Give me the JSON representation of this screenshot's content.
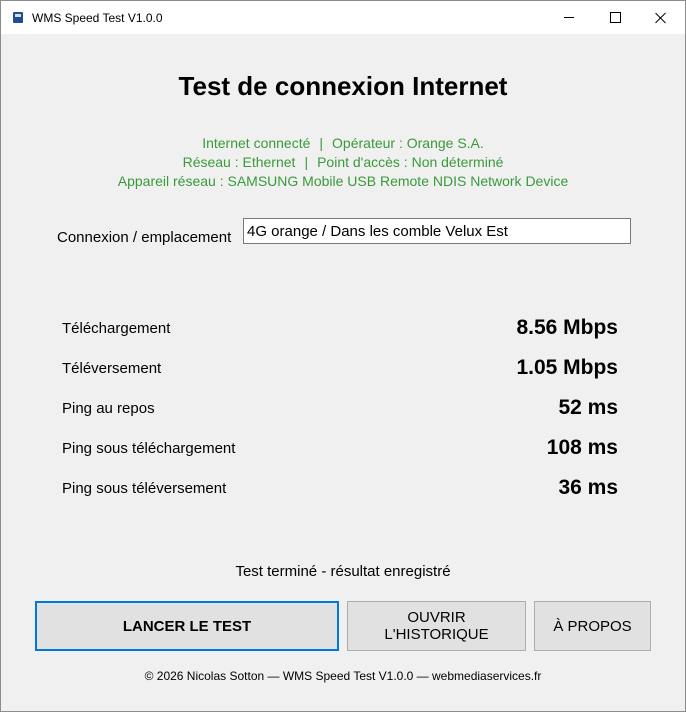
{
  "window": {
    "title": "WMS Speed Test V1.0.0",
    "minimize_icon": "minimize-icon",
    "maximize_icon": "maximize-icon",
    "close_icon": "close-icon"
  },
  "header": {
    "title": "Test de connexion Internet"
  },
  "status": {
    "connected": "Internet connecté",
    "operator": "Opérateur : Orange S.A.",
    "network": "Réseau : Ethernet",
    "access_point": "Point d'accès : Non déterminé",
    "device": "Appareil réseau : SAMSUNG Mobile USB Remote NDIS Network Device",
    "separator": "|",
    "color": "#3a9a3a"
  },
  "location": {
    "label": "Connexion / emplacement",
    "value": "4G orange / Dans les comble Velux Est"
  },
  "metrics": [
    {
      "label": "Téléchargement",
      "value": "8.56 Mbps"
    },
    {
      "label": "Téléversement",
      "value": "1.05 Mbps"
    },
    {
      "label": "Ping au repos",
      "value": "52 ms"
    },
    {
      "label": "Ping sous téléchargement",
      "value": "108 ms"
    },
    {
      "label": "Ping sous téléversement",
      "value": "36 ms"
    }
  ],
  "result_status": "Test terminé - résultat enregistré",
  "buttons": {
    "start": "LANCER LE TEST",
    "history": "OUVRIR L'HISTORIQUE",
    "about": "À PROPOS"
  },
  "footer": "© 2026 Nicolas Sotton — WMS Speed Test V1.0.0 — webmediaservices.fr",
  "colors": {
    "focus_border": "#0078d7",
    "button_bg": "#e1e1e1",
    "window_bg": "#f0f0f0"
  }
}
